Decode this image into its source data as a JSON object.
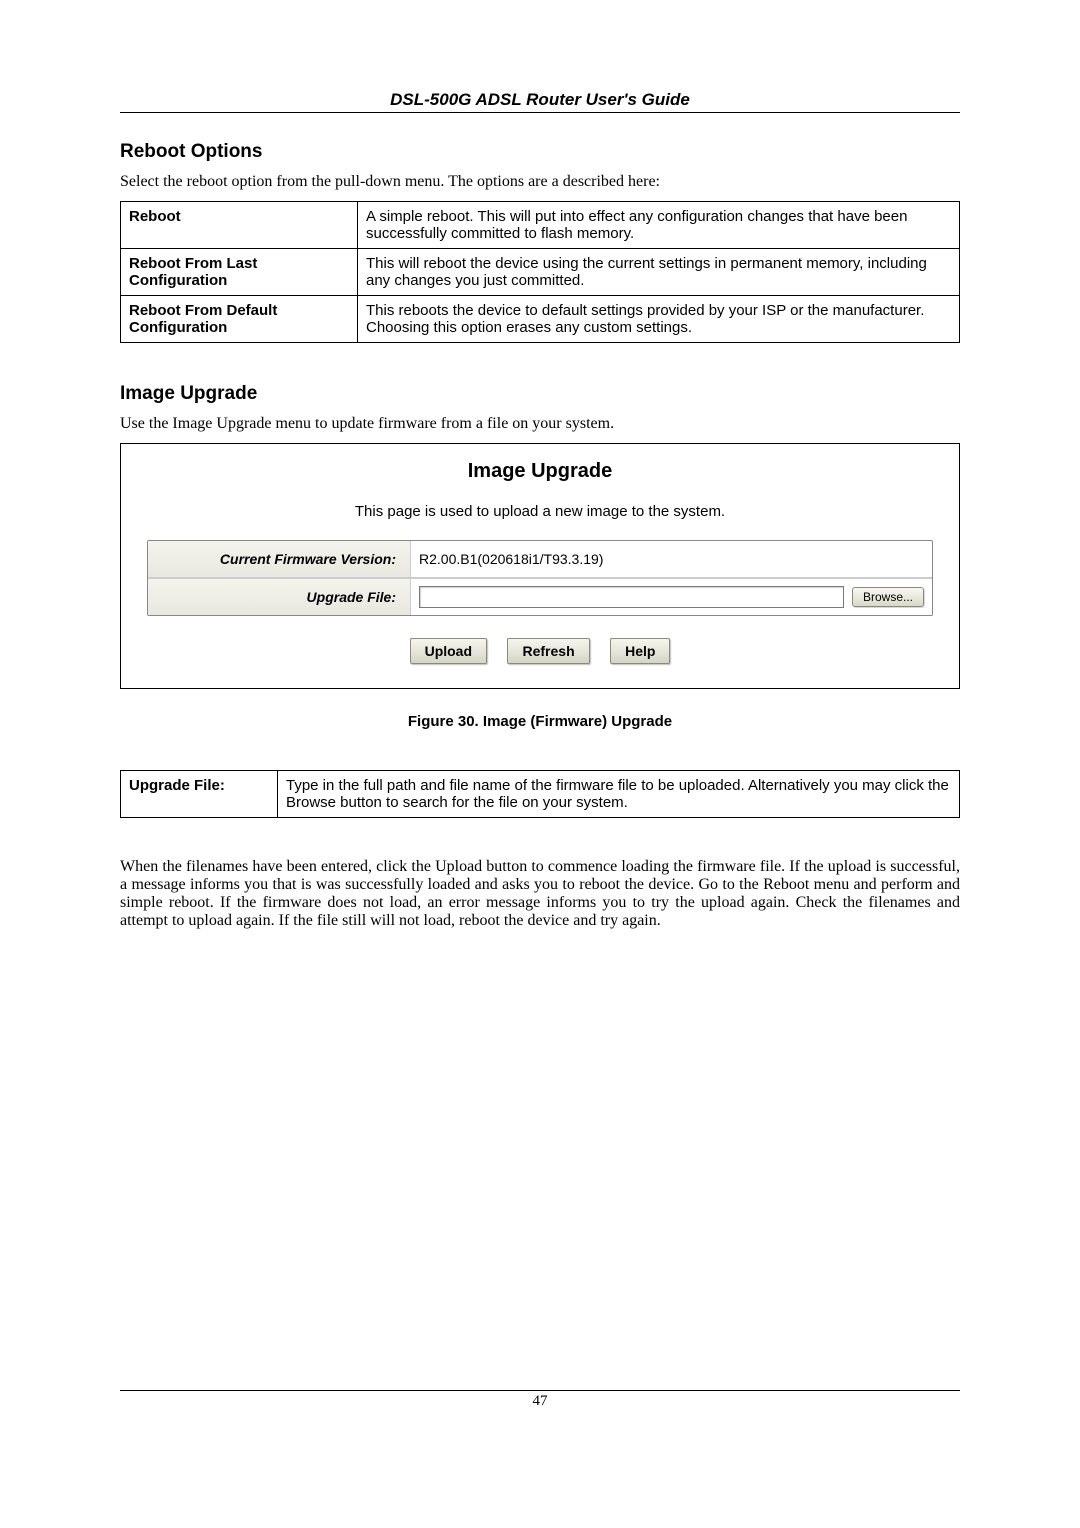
{
  "header": {
    "title": "DSL-500G ADSL Router User's Guide"
  },
  "reboot_section": {
    "heading": "Reboot Options",
    "intro": "Select the reboot option from the pull-down menu. The options are a described here:",
    "rows": [
      {
        "label": "Reboot",
        "desc": "A simple reboot. This will put into effect any configuration changes that have been successfully committed to flash memory."
      },
      {
        "label": "Reboot From Last Configuration",
        "desc": "This will reboot the device using the current settings in permanent memory, including any changes you just committed."
      },
      {
        "label": "Reboot From Default Configuration",
        "desc": "This reboots the device to default settings provided by your ISP or the manufacturer. Choosing this option erases any custom settings."
      }
    ]
  },
  "upgrade_section": {
    "heading": "Image Upgrade",
    "intro": "Use the Image Upgrade menu to update firmware from a file on your system."
  },
  "panel": {
    "title": "Image Upgrade",
    "subtitle": "This page is used to upload a new image to the system.",
    "current_label": "Current Firmware Version:",
    "current_value": "R2.00.B1(020618i1/T93.3.19)",
    "upgrade_label": "Upgrade File:",
    "upgrade_value": "",
    "browse_label": "Browse...",
    "upload_label": "Upload",
    "refresh_label": "Refresh",
    "help_label": "Help"
  },
  "figure_caption": "Figure 30. Image (Firmware) Upgrade",
  "upgrade_file_table": {
    "label": "Upgrade File:",
    "desc": "Type in the full path and file name of the firmware file to be uploaded. Alternatively you may click the Browse button to search for the file on your system."
  },
  "bottom_paragraph": "When the filenames have been entered, click the Upload button to commence loading the firmware file. If the upload is successful, a message informs you that is was successfully loaded and asks you to reboot the device. Go to the Reboot menu and perform and simple reboot. If the firmware does not load, an error message informs you to try the upload again. Check the filenames and attempt to upload again. If the file still will not load, reboot the device and try again.",
  "footer": {
    "page_number": "47"
  }
}
